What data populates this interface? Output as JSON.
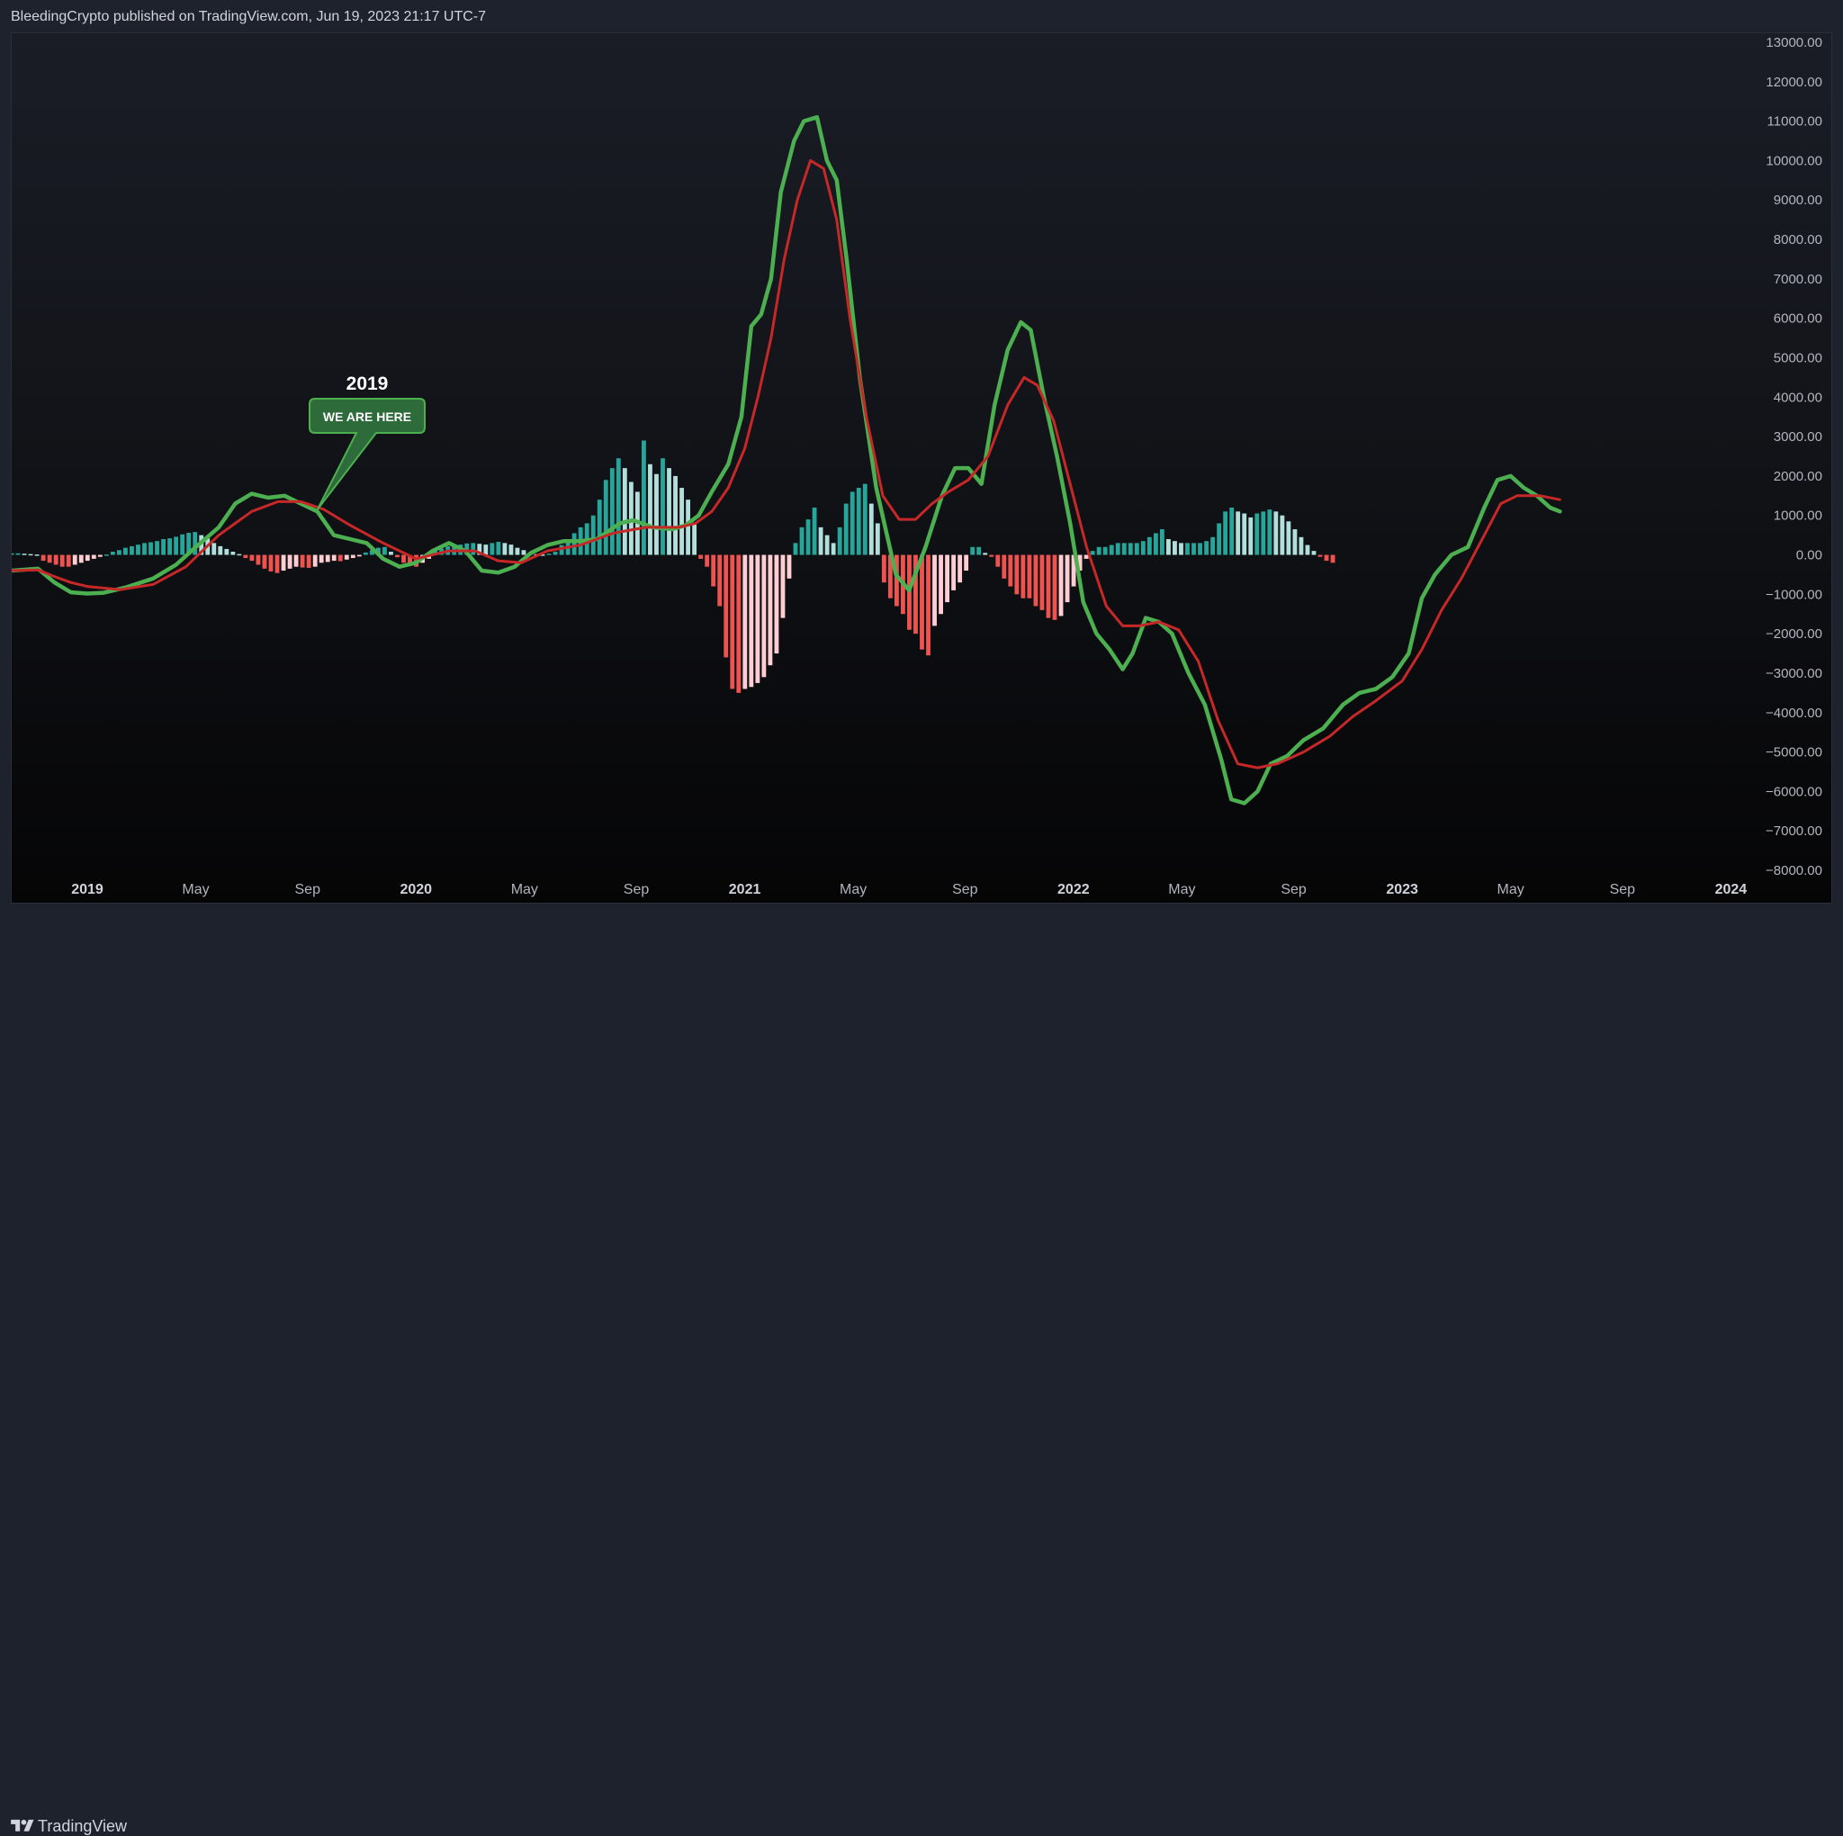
{
  "header": {
    "text": "BleedingCrypto published on TradingView.com, Jun 19, 2023 21:17 UTC-7"
  },
  "footer": {
    "brand": "TradingView"
  },
  "colors": {
    "background": "#131722",
    "macd_line": "#4caf50",
    "signal_line": "#c62828",
    "hist_up_strong": "#26a69a",
    "hist_up_weak": "#b2dfdb",
    "hist_down_strong": "#ef5350",
    "hist_down_weak": "#ffcdd2",
    "annotation_fill": "#2e6b3a",
    "annotation_border": "#4caf50"
  },
  "annotation": {
    "title": "2019",
    "label": "WE ARE HERE"
  },
  "chart_data": {
    "type": "line",
    "title": "",
    "x_axis": {
      "range": [
        2018.77,
        2024.04
      ],
      "ticks": [
        {
          "label": "2019",
          "value": 2019.0,
          "major": true
        },
        {
          "label": "May",
          "value": 2019.33,
          "major": false
        },
        {
          "label": "Sep",
          "value": 2019.67,
          "major": false
        },
        {
          "label": "2020",
          "value": 2020.0,
          "major": true
        },
        {
          "label": "May",
          "value": 2020.33,
          "major": false
        },
        {
          "label": "Sep",
          "value": 2020.67,
          "major": false
        },
        {
          "label": "2021",
          "value": 2021.0,
          "major": true
        },
        {
          "label": "May",
          "value": 2021.33,
          "major": false
        },
        {
          "label": "Sep",
          "value": 2021.67,
          "major": false
        },
        {
          "label": "2022",
          "value": 2022.0,
          "major": true
        },
        {
          "label": "May",
          "value": 2022.33,
          "major": false
        },
        {
          "label": "Sep",
          "value": 2022.67,
          "major": false
        },
        {
          "label": "2023",
          "value": 2023.0,
          "major": true
        },
        {
          "label": "May",
          "value": 2023.33,
          "major": false
        },
        {
          "label": "Sep",
          "value": 2023.67,
          "major": false
        },
        {
          "label": "2024",
          "value": 2024.0,
          "major": true
        }
      ]
    },
    "y_axis": {
      "range": [
        -8000,
        13000
      ],
      "ticks": [
        "13000.00",
        "12000.00",
        "11000.00",
        "10000.00",
        "9000.00",
        "8000.00",
        "7000.00",
        "6000.00",
        "5000.00",
        "4000.00",
        "3000.00",
        "2000.00",
        "1000.00",
        "0.00",
        "−1000.00",
        "−2000.00",
        "−3000.00",
        "−4000.00",
        "−5000.00",
        "−6000.00",
        "−7000.00",
        "−8000.00"
      ],
      "tick_values": [
        13000,
        12000,
        11000,
        10000,
        9000,
        8000,
        7000,
        6000,
        5000,
        4000,
        3000,
        2000,
        1000,
        0,
        -1000,
        -2000,
        -3000,
        -4000,
        -5000,
        -6000,
        -7000,
        -8000
      ]
    },
    "series": [
      {
        "key": "macd",
        "points": [
          [
            2018.77,
            -400
          ],
          [
            2018.85,
            -350
          ],
          [
            2018.9,
            -700
          ],
          [
            2018.95,
            -950
          ],
          [
            2019.0,
            -980
          ],
          [
            2019.05,
            -960
          ],
          [
            2019.12,
            -820
          ],
          [
            2019.2,
            -600
          ],
          [
            2019.27,
            -250
          ],
          [
            2019.33,
            200
          ],
          [
            2019.4,
            700
          ],
          [
            2019.45,
            1300
          ],
          [
            2019.5,
            1550
          ],
          [
            2019.55,
            1450
          ],
          [
            2019.6,
            1500
          ],
          [
            2019.65,
            1300
          ],
          [
            2019.7,
            1100
          ],
          [
            2019.75,
            500
          ],
          [
            2019.8,
            400
          ],
          [
            2019.85,
            300
          ],
          [
            2019.9,
            -100
          ],
          [
            2019.95,
            -300
          ],
          [
            2020.0,
            -200
          ],
          [
            2020.05,
            100
          ],
          [
            2020.1,
            300
          ],
          [
            2020.15,
            100
          ],
          [
            2020.2,
            -400
          ],
          [
            2020.25,
            -450
          ],
          [
            2020.3,
            -300
          ],
          [
            2020.35,
            50
          ],
          [
            2020.4,
            250
          ],
          [
            2020.45,
            350
          ],
          [
            2020.5,
            350
          ],
          [
            2020.55,
            400
          ],
          [
            2020.62,
            800
          ],
          [
            2020.66,
            880
          ],
          [
            2020.72,
            700
          ],
          [
            2020.78,
            650
          ],
          [
            2020.82,
            750
          ],
          [
            2020.86,
            1000
          ],
          [
            2020.9,
            1600
          ],
          [
            2020.95,
            2300
          ],
          [
            2020.99,
            3500
          ],
          [
            2021.02,
            5800
          ],
          [
            2021.05,
            6100
          ],
          [
            2021.08,
            7000
          ],
          [
            2021.11,
            9200
          ],
          [
            2021.15,
            10500
          ],
          [
            2021.18,
            11000
          ],
          [
            2021.22,
            11100
          ],
          [
            2021.25,
            10000
          ],
          [
            2021.28,
            9500
          ],
          [
            2021.31,
            7500
          ],
          [
            2021.35,
            4500
          ],
          [
            2021.4,
            1700
          ],
          [
            2021.46,
            -500
          ],
          [
            2021.5,
            -900
          ],
          [
            2021.55,
            200
          ],
          [
            2021.6,
            1500
          ],
          [
            2021.64,
            2200
          ],
          [
            2021.68,
            2200
          ],
          [
            2021.72,
            1800
          ],
          [
            2021.76,
            3800
          ],
          [
            2021.8,
            5200
          ],
          [
            2021.84,
            5900
          ],
          [
            2021.87,
            5700
          ],
          [
            2021.91,
            4000
          ],
          [
            2021.95,
            2500
          ],
          [
            2021.99,
            800
          ],
          [
            2022.03,
            -1200
          ],
          [
            2022.07,
            -2000
          ],
          [
            2022.11,
            -2400
          ],
          [
            2022.15,
            -2900
          ],
          [
            2022.18,
            -2500
          ],
          [
            2022.22,
            -1600
          ],
          [
            2022.26,
            -1700
          ],
          [
            2022.3,
            -2000
          ],
          [
            2022.35,
            -3000
          ],
          [
            2022.4,
            -3800
          ],
          [
            2022.45,
            -5200
          ],
          [
            2022.48,
            -6200
          ],
          [
            2022.52,
            -6300
          ],
          [
            2022.56,
            -6000
          ],
          [
            2022.6,
            -5300
          ],
          [
            2022.65,
            -5100
          ],
          [
            2022.7,
            -4700
          ],
          [
            2022.76,
            -4400
          ],
          [
            2022.82,
            -3800
          ],
          [
            2022.87,
            -3500
          ],
          [
            2022.92,
            -3400
          ],
          [
            2022.97,
            -3100
          ],
          [
            2023.02,
            -2500
          ],
          [
            2023.06,
            -1100
          ],
          [
            2023.1,
            -500
          ],
          [
            2023.15,
            0
          ],
          [
            2023.2,
            200
          ],
          [
            2023.25,
            1200
          ],
          [
            2023.29,
            1900
          ],
          [
            2023.33,
            2000
          ],
          [
            2023.37,
            1700
          ],
          [
            2023.41,
            1500
          ],
          [
            2023.45,
            1200
          ],
          [
            2023.48,
            1100
          ]
        ]
      },
      {
        "key": "signal",
        "points": [
          [
            2018.77,
            -400
          ],
          [
            2018.85,
            -380
          ],
          [
            2018.9,
            -550
          ],
          [
            2018.95,
            -700
          ],
          [
            2019.0,
            -800
          ],
          [
            2019.1,
            -880
          ],
          [
            2019.2,
            -750
          ],
          [
            2019.3,
            -300
          ],
          [
            2019.4,
            500
          ],
          [
            2019.5,
            1100
          ],
          [
            2019.58,
            1350
          ],
          [
            2019.65,
            1350
          ],
          [
            2019.72,
            1150
          ],
          [
            2019.8,
            750
          ],
          [
            2019.9,
            300
          ],
          [
            2020.0,
            -100
          ],
          [
            2020.1,
            100
          ],
          [
            2020.18,
            100
          ],
          [
            2020.25,
            -150
          ],
          [
            2020.32,
            -200
          ],
          [
            2020.4,
            100
          ],
          [
            2020.5,
            250
          ],
          [
            2020.6,
            550
          ],
          [
            2020.7,
            700
          ],
          [
            2020.8,
            700
          ],
          [
            2020.85,
            800
          ],
          [
            2020.9,
            1100
          ],
          [
            2020.95,
            1700
          ],
          [
            2021.0,
            2700
          ],
          [
            2021.04,
            4000
          ],
          [
            2021.08,
            5500
          ],
          [
            2021.12,
            7500
          ],
          [
            2021.16,
            9000
          ],
          [
            2021.2,
            10000
          ],
          [
            2021.24,
            9800
          ],
          [
            2021.28,
            8500
          ],
          [
            2021.32,
            6000
          ],
          [
            2021.37,
            3500
          ],
          [
            2021.42,
            1500
          ],
          [
            2021.47,
            900
          ],
          [
            2021.52,
            900
          ],
          [
            2021.57,
            1300
          ],
          [
            2021.62,
            1600
          ],
          [
            2021.68,
            1900
          ],
          [
            2021.74,
            2500
          ],
          [
            2021.8,
            3800
          ],
          [
            2021.85,
            4500
          ],
          [
            2021.89,
            4300
          ],
          [
            2021.94,
            3400
          ],
          [
            2021.99,
            1800
          ],
          [
            2022.04,
            200
          ],
          [
            2022.1,
            -1300
          ],
          [
            2022.15,
            -1800
          ],
          [
            2022.2,
            -1800
          ],
          [
            2022.26,
            -1700
          ],
          [
            2022.32,
            -1900
          ],
          [
            2022.38,
            -2700
          ],
          [
            2022.44,
            -4200
          ],
          [
            2022.5,
            -5300
          ],
          [
            2022.56,
            -5400
          ],
          [
            2022.62,
            -5300
          ],
          [
            2022.7,
            -5000
          ],
          [
            2022.78,
            -4600
          ],
          [
            2022.85,
            -4100
          ],
          [
            2022.92,
            -3700
          ],
          [
            2023.0,
            -3200
          ],
          [
            2023.06,
            -2400
          ],
          [
            2023.12,
            -1400
          ],
          [
            2023.18,
            -600
          ],
          [
            2023.25,
            500
          ],
          [
            2023.3,
            1300
          ],
          [
            2023.35,
            1500
          ],
          [
            2023.42,
            1500
          ],
          [
            2023.48,
            1400
          ]
        ]
      }
    ],
    "histogram": {
      "x_start": 2018.77,
      "step": 0.01923,
      "values": [
        40,
        40,
        30,
        20,
        10,
        -150,
        -200,
        -250,
        -300,
        -300,
        -250,
        -200,
        -150,
        -100,
        -50,
        10,
        80,
        120,
        180,
        220,
        260,
        300,
        320,
        350,
        400,
        420,
        460,
        520,
        560,
        580,
        500,
        420,
        300,
        220,
        150,
        80,
        20,
        -80,
        -150,
        -250,
        -350,
        -420,
        -460,
        -400,
        -350,
        -300,
        -320,
        -330,
        -300,
        -200,
        -180,
        -150,
        -160,
        -120,
        -80,
        -40,
        60,
        120,
        180,
        200,
        80,
        -60,
        -200,
        -250,
        -300,
        -200,
        -100,
        100,
        160,
        220,
        240,
        260,
        290,
        300,
        280,
        260,
        300,
        330,
        300,
        260,
        180,
        120,
        60,
        20,
        10,
        30,
        80,
        250,
        400,
        550,
        700,
        800,
        1000,
        1400,
        1900,
        2200,
        2450,
        2200,
        1850,
        1600,
        2900,
        2300,
        2050,
        2450,
        2200,
        2000,
        1700,
        1400,
        800,
        -100,
        -300,
        -800,
        -1300,
        -2600,
        -3400,
        -3500,
        -3400,
        -3350,
        -3250,
        -3100,
        -2800,
        -2500,
        -1600,
        -600,
        300,
        700,
        900,
        1200,
        700,
        500,
        300,
        700,
        1300,
        1600,
        1700,
        1800,
        1300,
        800,
        -700,
        -1100,
        -1300,
        -1500,
        -1900,
        -2000,
        -2400,
        -2550,
        -1800,
        -1500,
        -1200,
        -900,
        -700,
        -400,
        200,
        200,
        50,
        -50,
        -300,
        -600,
        -800,
        -1000,
        -1100,
        -1100,
        -1300,
        -1400,
        -1600,
        -1650,
        -1550,
        -1200,
        -800,
        -400,
        -100,
        100,
        200,
        200,
        250,
        300,
        300,
        300,
        300,
        350,
        450,
        550,
        650,
        400,
        350,
        300,
        300,
        300,
        300,
        350,
        450,
        800,
        1100,
        1200,
        1100,
        1050,
        950,
        1050,
        1100,
        1150,
        1100,
        1000,
        850,
        650,
        450,
        250,
        100,
        -50,
        -150,
        -200
      ]
    }
  }
}
